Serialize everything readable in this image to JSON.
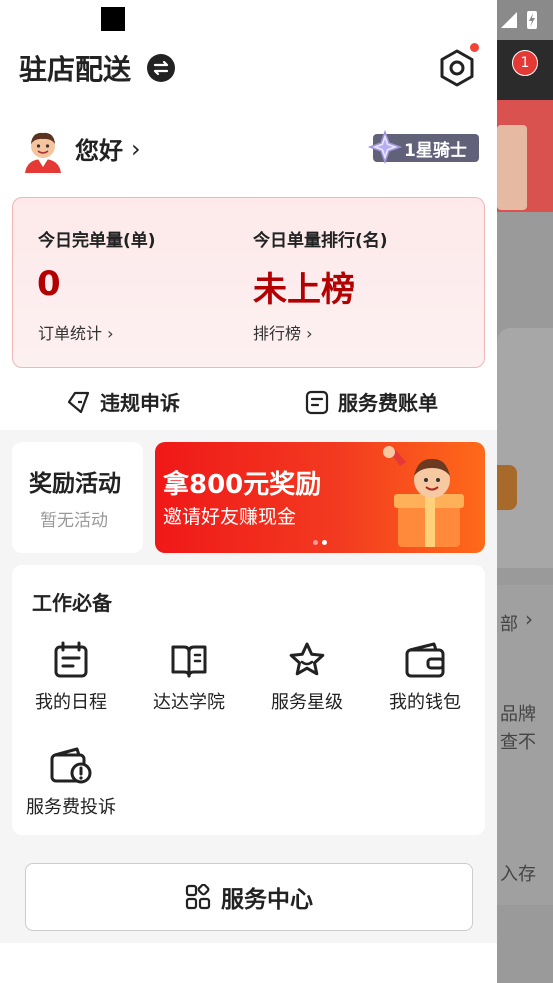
{
  "header": {
    "title": "驻店配送"
  },
  "user": {
    "greeting": "您好",
    "rank": "1星骑士"
  },
  "stats": {
    "left_label": "今日完单量(单)",
    "left_value": "0",
    "left_link": "订单统计",
    "right_label": "今日单量排行(名)",
    "right_value": "未上榜",
    "right_link": "排行榜"
  },
  "actions": {
    "appeal": "违规申诉",
    "bill": "服务费账单"
  },
  "reward": {
    "title": "奖励活动",
    "subtitle": "暂无活动"
  },
  "banner": {
    "title": "拿800元奖励",
    "subtitle": "邀请好友赚现金"
  },
  "work": {
    "title": "工作必备",
    "items": [
      {
        "label": "我的日程",
        "icon": "calendar-icon"
      },
      {
        "label": "达达学院",
        "icon": "book-icon"
      },
      {
        "label": "服务星级",
        "icon": "star-icon"
      },
      {
        "label": "我的钱包",
        "icon": "wallet-icon"
      },
      {
        "label": "服务费投诉",
        "icon": "wallet-alert-icon"
      }
    ]
  },
  "footer": {
    "service_center": "服务中心"
  },
  "background": {
    "badge": "1",
    "text1": "部",
    "text2": "品牌",
    "text3": "查不",
    "text4": "入存"
  },
  "colors": {
    "accent_red": "#b30000",
    "banner_red": "#f01818"
  }
}
